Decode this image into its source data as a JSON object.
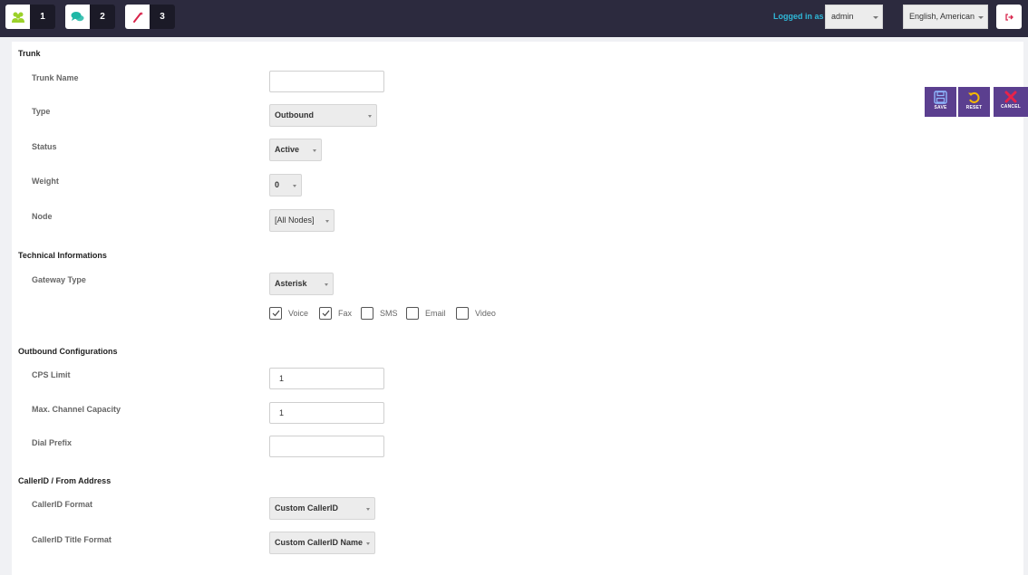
{
  "topbar": {
    "buttons": [
      {
        "icon": "users-icon",
        "count": "1"
      },
      {
        "icon": "chat-icon",
        "count": "2"
      },
      {
        "icon": "magic-wand-icon",
        "count": "3"
      }
    ],
    "logged_in_label": "Logged in as :",
    "user": "admin",
    "language": "English, American",
    "logout_icon": "logout-icon"
  },
  "actions": {
    "save": "SAVE",
    "reset": "RESET",
    "cancel": "CANCEL"
  },
  "form": {
    "trunk": {
      "title": "Trunk",
      "trunk_name": {
        "label": "Trunk Name",
        "value": ""
      },
      "type": {
        "label": "Type",
        "value": "Outbound"
      },
      "status": {
        "label": "Status",
        "value": "Active"
      },
      "weight": {
        "label": "Weight",
        "value": "0"
      },
      "node": {
        "label": "Node",
        "value": "[All Nodes]"
      }
    },
    "technical": {
      "title": "Technical Informations",
      "gateway_type": {
        "label": "Gateway Type",
        "value": "Asterisk"
      },
      "media": [
        {
          "label": "Voice",
          "checked": true
        },
        {
          "label": "Fax",
          "checked": true
        },
        {
          "label": "SMS",
          "checked": false
        },
        {
          "label": "Email",
          "checked": false
        },
        {
          "label": "Video",
          "checked": false
        }
      ]
    },
    "outbound": {
      "title": "Outbound Configurations",
      "cps_limit": {
        "label": "CPS Limit",
        "value": "1"
      },
      "max_channel": {
        "label": "Max. Channel Capacity",
        "value": "1"
      },
      "dial_prefix": {
        "label": "Dial Prefix",
        "value": ""
      }
    },
    "callerid": {
      "title": "CallerID / From Address",
      "format": {
        "label": "CallerID Format",
        "value": "Custom CallerID"
      },
      "title_format": {
        "label": "CallerID Title Format",
        "value": "Custom CallerID Name"
      }
    }
  },
  "colors": {
    "topbar": "#2c2a3e",
    "accent": "#2fb8d8",
    "action_bg": "#5b3f8f"
  }
}
